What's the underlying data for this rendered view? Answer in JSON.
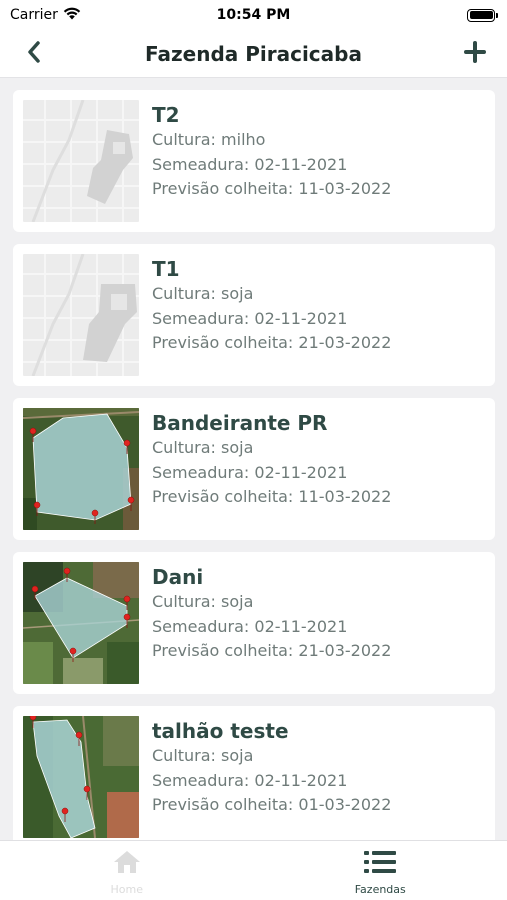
{
  "status_bar": {
    "carrier": "Carrier",
    "time": "10:54 PM"
  },
  "nav": {
    "title": "Fazenda Piracicaba"
  },
  "fields": [
    {
      "name": "T2",
      "crop": "Cultura: milho",
      "sowing": "Semeadura: 02-11-2021",
      "harvest": "Previsão colheita: 11-03-2022",
      "map": "blank"
    },
    {
      "name": "T1",
      "crop": "Cultura: soja",
      "sowing": "Semeadura: 02-11-2021",
      "harvest": "Previsão colheita: 21-03-2022",
      "map": "blank"
    },
    {
      "name": "Bandeirante PR",
      "crop": "Cultura: soja",
      "sowing": "Semeadura: 02-11-2021",
      "harvest": "Previsão colheita: 11-03-2022",
      "map": "satellite-polygon"
    },
    {
      "name": "Dani",
      "crop": "Cultura: soja",
      "sowing": "Semeadura: 02-11-2021",
      "harvest": "Previsão colheita: 21-03-2022",
      "map": "satellite-polygon"
    },
    {
      "name": "talhão teste",
      "crop": "Cultura: soja",
      "sowing": "Semeadura: 02-11-2021",
      "harvest": "Previsão colheita: 01-03-2022",
      "map": "satellite-polygon"
    }
  ],
  "tabs": [
    {
      "label": "Home",
      "icon": "home-icon",
      "active": false
    },
    {
      "label": "Fazendas",
      "icon": "list-icon",
      "active": true
    }
  ],
  "colors": {
    "accent": "#2f4a45",
    "muted_text": "#6f7b79",
    "polygon_fill": "#a9d3d6",
    "pin": "#e0231f"
  }
}
